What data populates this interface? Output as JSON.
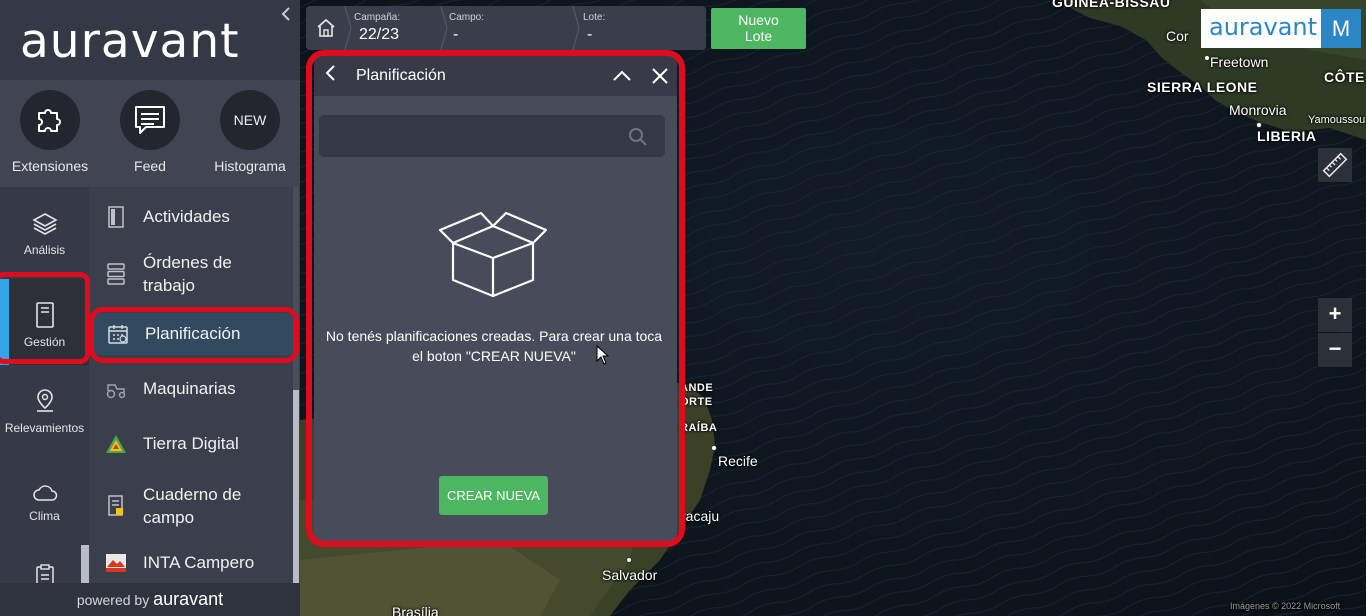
{
  "sidebar": {
    "logo": "auravant",
    "quick_actions": [
      {
        "label": "Extensiones",
        "icon": "puzzle-icon"
      },
      {
        "label": "Feed",
        "icon": "chat-icon"
      },
      {
        "label": "Histograma",
        "icon": "new-badge",
        "badge": "NEW"
      }
    ],
    "left_nav": [
      {
        "label": "Análisis",
        "icon": "layers-icon"
      },
      {
        "label": "Gestión",
        "icon": "notebook-icon",
        "active": true
      },
      {
        "label": "Relevamientos",
        "icon": "location-pin-icon"
      },
      {
        "label": "Clima",
        "icon": "cloud-icon"
      },
      {
        "label": "",
        "icon": "clipboard-icon"
      }
    ],
    "sub_nav": [
      {
        "label": "Actividades",
        "icon": "notebook-icon"
      },
      {
        "label": "Órdenes de trabajo",
        "icon": "list-stack-icon"
      },
      {
        "label": "Planificación",
        "icon": "calendar-icon",
        "active": true
      },
      {
        "label": "Maquinarias",
        "icon": "tractor-icon"
      },
      {
        "label": "Tierra Digital",
        "icon": "tierra-digital-icon"
      },
      {
        "label": "Cuaderno de campo",
        "icon": "field-notebook-icon"
      },
      {
        "label": "INTA Campero",
        "icon": "inta-icon"
      }
    ],
    "powered_prefix": "powered by",
    "powered_brand": "auravant"
  },
  "topbar": {
    "campaign_label": "Campaña:",
    "campaign_value": "22/23",
    "field_label": "Campo:",
    "field_value": "-",
    "lot_label": "Lote:",
    "lot_value": "-",
    "new_lot_line1": "Nuevo",
    "new_lot_line2": "Lote"
  },
  "panel": {
    "title": "Planificación",
    "search_placeholder": "",
    "empty_line1": "No tenés planificaciones creadas. Para crear una toca",
    "empty_line2": "el boton \"CREAR NUEVA\"",
    "create_button": "CREAR NUEVA"
  },
  "map": {
    "brand": "auravant",
    "user_initial": "M",
    "labels": {
      "guinea_bissau": "GUINEA-BISSAU",
      "conakry": "Cor",
      "freetown": "Freetown",
      "cote": "CÔTE",
      "sierra_leone": "SIERRA LEONE",
      "monrovia": "Monrovia",
      "yamoussoukro": "Yamoussou",
      "liberia": "LIBERIA",
      "rio_grande": "ANDE",
      "norte": "ORTE",
      "paraiba": "RAÍBA",
      "recife": "Recife",
      "aracaju": "racaju",
      "salvador": "Salvador",
      "brasilia": "Brasília"
    },
    "attribution": "Imágenes © 2022 Microsoft",
    "zoom_in": "+",
    "zoom_out": "−"
  },
  "colors": {
    "accent_blue": "#33a6e8",
    "brand_blue": "#2b86c5",
    "action_green": "#4cb661",
    "highlight_red": "#e00b1c"
  }
}
